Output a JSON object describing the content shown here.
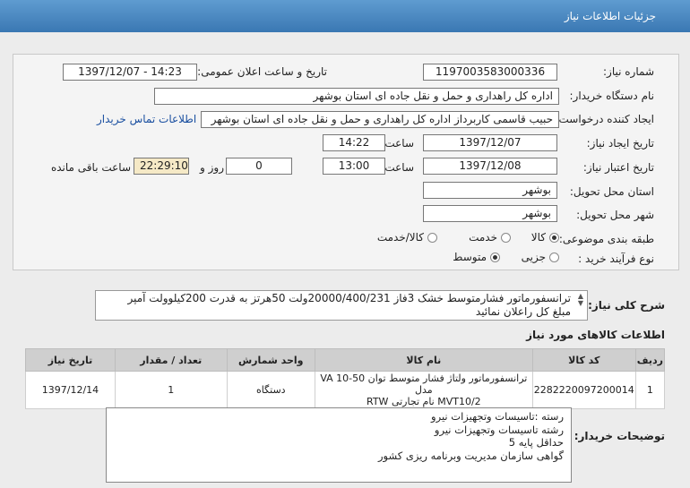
{
  "window": {
    "title": "جزئیات اطلاعات نیاز"
  },
  "labels": {
    "need_number": "شماره نیاز:",
    "announce_datetime": "تاریخ و ساعت اعلان عمومی:",
    "buyer_org": "نام دستگاه خریدار:",
    "requester": "ایجاد کننده درخواست:",
    "need_created": "تاریخ ایجاد نیاز:",
    "need_valid": "تاریخ اعتبار نیاز:",
    "time": "ساعت",
    "day_and": "روز و",
    "remaining": "ساعت باقی مانده",
    "delivery_province": "استان محل تحویل:",
    "delivery_city": "شهر محل تحویل:",
    "subject_category": "طبقه بندی موضوعی:",
    "purchase_process": "نوع فرآیند خرید :",
    "general_desc": "شرح کلی نیاز:",
    "goods_info": "اطلاعات کالاهای مورد نیاز",
    "buyer_notes": "توضیحات خریدار:"
  },
  "fields": {
    "need_number": "1197003583000336",
    "announce_datetime": "1397/12/07 - 14:23",
    "buyer_org": "اداره کل راهداری و حمل و نقل جاده ای استان بوشهر",
    "requester": "حبیب قاسمی کاربرداز اداره کل راهداری و حمل و نقل جاده ای استان بوشهر",
    "contact_link": "اطلاعات تماس خریدار",
    "created_date": "1397/12/07",
    "created_time": "14:22",
    "valid_date": "1397/12/08",
    "valid_time": "13:00",
    "days": "0",
    "remaining_time": "22:29:10",
    "province": "بوشهر",
    "city": "بوشهر"
  },
  "subject_options": [
    {
      "label": "کالا",
      "selected": true
    },
    {
      "label": "خدمت",
      "selected": false
    },
    {
      "label": "کالا/خدمت",
      "selected": false
    }
  ],
  "process_options": [
    {
      "label": "جزیی",
      "selected": false
    },
    {
      "label": "متوسط",
      "selected": true
    }
  ],
  "general_desc": {
    "line1": "ترانسفورماتور فشارمتوسط خشک 3فاز 20000/400/231ولت 50هرتز به قدرت 200کیلوولت آمپر",
    "line2": "مبلغ کل راعلان نمائید"
  },
  "table": {
    "headers": [
      "ردیف",
      "کد کالا",
      "نام کالا",
      "واحد شمارش",
      "تعداد / مقدار",
      "تاریخ نیاز"
    ],
    "rows": [
      {
        "row": "1",
        "code": "2282220097200014",
        "name_line1": "ترانسفورماتور ولتاژ فشار متوسط توان VA 10-50 مدل",
        "name_line2": "MVT10/2 نام تجارتی RTW",
        "unit": "دستگاه",
        "qty": "1",
        "date": "1397/12/14"
      }
    ]
  },
  "notes": [
    "رسته :تاسیسات وتجهیزات نیرو",
    "رشته تاسیسات وتجهیزات نیرو",
    "حداقل پایه 5",
    "گواهی سازمان مدیریت وبرنامه ریزی کشور"
  ]
}
